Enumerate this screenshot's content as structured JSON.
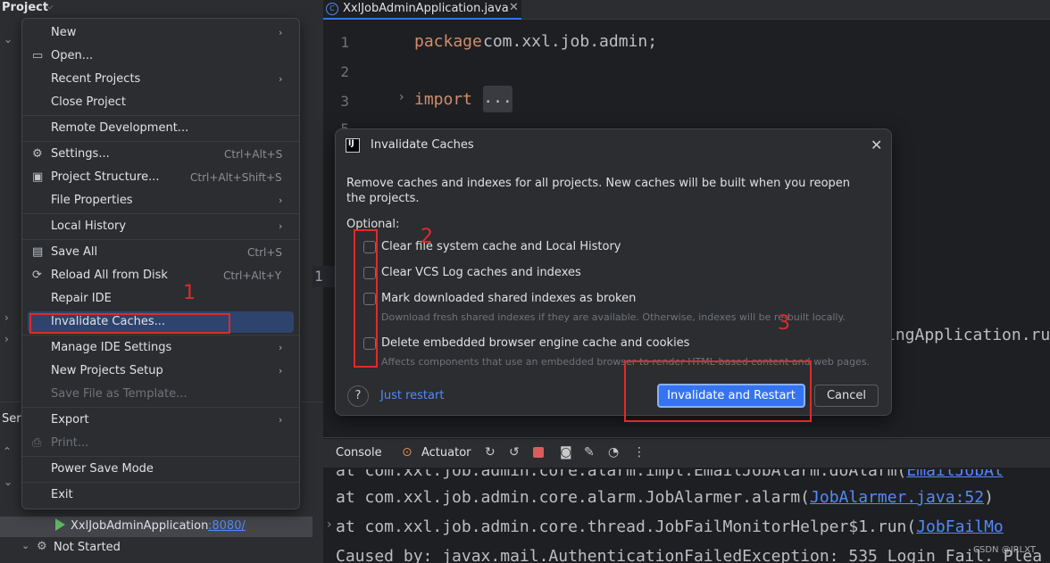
{
  "project_panel": {
    "title": "Project",
    "services_label": "Ser",
    "run_config": {
      "app": "XxlJobAdminApplication",
      "port": ":8080/"
    },
    "not_started": "Not Started"
  },
  "editor": {
    "tab_title": "XxlJobAdminApplication.java",
    "lines": [
      {
        "no": "1",
        "kw": "package",
        "text": " com.xxl.job.admin;"
      },
      {
        "no": "2",
        "kw": "",
        "text": ""
      },
      {
        "no": "3",
        "kw": "import",
        "text": " "
      }
    ],
    "folded": "...",
    "partial_line_no": "5",
    "current_line_no": "1",
    "code_fragment": "ingApplication.ru"
  },
  "menu": {
    "items": [
      {
        "label": "New",
        "shortcut": "",
        "arrow": true,
        "icon": "",
        "disabled": false
      },
      {
        "label": "Open...",
        "shortcut": "",
        "arrow": false,
        "icon": "folder-icon",
        "disabled": false
      },
      {
        "label": "Recent Projects",
        "shortcut": "",
        "arrow": true,
        "icon": "",
        "disabled": false
      },
      {
        "label": "Close Project",
        "shortcut": "",
        "arrow": false,
        "icon": "",
        "disabled": false
      },
      {
        "label": "Remote Development...",
        "shortcut": "",
        "arrow": false,
        "icon": "",
        "disabled": false
      },
      {
        "label": "Settings...",
        "shortcut": "Ctrl+Alt+S",
        "arrow": false,
        "icon": "gear-icon",
        "disabled": false
      },
      {
        "label": "Project Structure...",
        "shortcut": "Ctrl+Alt+Shift+S",
        "arrow": false,
        "icon": "project-structure-icon",
        "disabled": false
      },
      {
        "label": "File Properties",
        "shortcut": "",
        "arrow": true,
        "icon": "",
        "disabled": false
      },
      {
        "label": "Local History",
        "shortcut": "",
        "arrow": true,
        "icon": "",
        "disabled": false
      },
      {
        "label": "Save All",
        "shortcut": "Ctrl+S",
        "arrow": false,
        "icon": "save-icon",
        "disabled": false
      },
      {
        "label": "Reload All from Disk",
        "shortcut": "Ctrl+Alt+Y",
        "arrow": false,
        "icon": "reload-icon",
        "disabled": false
      },
      {
        "label": "Repair IDE",
        "shortcut": "",
        "arrow": false,
        "icon": "",
        "disabled": false
      },
      {
        "label": "Invalidate Caches...",
        "shortcut": "",
        "arrow": false,
        "icon": "",
        "disabled": false
      },
      {
        "label": "Manage IDE Settings",
        "shortcut": "",
        "arrow": true,
        "icon": "",
        "disabled": false
      },
      {
        "label": "New Projects Setup",
        "shortcut": "",
        "arrow": true,
        "icon": "",
        "disabled": false
      },
      {
        "label": "Save File as Template...",
        "shortcut": "",
        "arrow": false,
        "icon": "",
        "disabled": true
      },
      {
        "label": "Export",
        "shortcut": "",
        "arrow": true,
        "icon": "",
        "disabled": false
      },
      {
        "label": "Print...",
        "shortcut": "",
        "arrow": false,
        "icon": "print-icon",
        "disabled": true
      },
      {
        "label": "Power Save Mode",
        "shortcut": "",
        "arrow": false,
        "icon": "",
        "disabled": false
      },
      {
        "label": "Exit",
        "shortcut": "",
        "arrow": false,
        "icon": "",
        "disabled": false
      }
    ]
  },
  "dialog": {
    "title": "Invalidate Caches",
    "description": "Remove caches and indexes for all projects. New caches will be built when you reopen the projects.",
    "optional_label": "Optional:",
    "options": [
      {
        "label": "Clear file system cache and Local History",
        "hint": "",
        "checked": false
      },
      {
        "label": "Clear VCS Log caches and indexes",
        "hint": "",
        "checked": false
      },
      {
        "label": "Mark downloaded shared indexes as broken",
        "hint": "Download fresh shared indexes if they are available. Otherwise, indexes will be re-built locally.",
        "checked": false
      },
      {
        "label": "Delete embedded browser engine cache and cookies",
        "hint": "Affects components that use an embedded browser to render HTML-based content and web pages.",
        "checked": false
      }
    ],
    "help": "?",
    "just_restart": "Just restart",
    "primary_button": "Invalidate and Restart",
    "cancel_button": "Cancel"
  },
  "console": {
    "tab_console": "Console",
    "tab_actuator": "Actuator",
    "lines": [
      {
        "prefix": "    at com.xxl.job.admin.core.alarm.impl.EmailJobAlarm.doAlarm(",
        "link": "EmailJobAl"
      },
      {
        "prefix": "    at com.xxl.job.admin.core.alarm.JobAlarmer.alarm(",
        "link": "JobAlarmer.java:52",
        "suffix": ")"
      },
      {
        "prefix": "    at com.xxl.job.admin.core.thread.JobFailMonitorHelper$1.run(",
        "link": "JobFailMo"
      },
      {
        "prefix": "Caused by: javax.mail.AuthenticationFailedException: 535 Login Fail. Plea",
        "link": ""
      }
    ]
  },
  "annotations": [
    "1",
    "2",
    "3"
  ],
  "watermark": "CSDN @JRLXT",
  "colors": {
    "accent": "#3574f0",
    "annotation_red": "#e02a2a",
    "keyword": "#cf8e6d"
  }
}
